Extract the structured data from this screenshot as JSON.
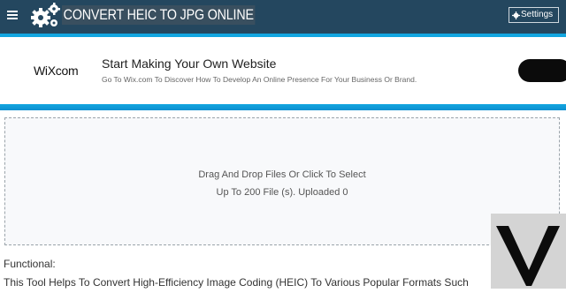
{
  "header": {
    "menu_icon": "hamburger-icon",
    "logo_icon": "gears-icon",
    "title": "CONVERT HEIC TO JPG ONLINE",
    "settings_label": "Settings",
    "settings_icon": "gear-icon",
    "colors": {
      "bar": "#24475f",
      "accent": "#12a6e0"
    }
  },
  "ad": {
    "brand": "WiXcom",
    "title": "Start Making Your Own Website",
    "description": "Go To Wix.com To Discover How To Develop An Online Presence For Your Business Or Brand."
  },
  "dropzone": {
    "line1": "Drag And Drop Files Or Click To Select",
    "line2": "Up To 200 File (s). Uploaded 0"
  },
  "content": {
    "functional_label": "Functional:",
    "description": "This Tool Helps To Convert High-Efficiency Image Coding (HEIC) To Various Popular Formats Such"
  }
}
